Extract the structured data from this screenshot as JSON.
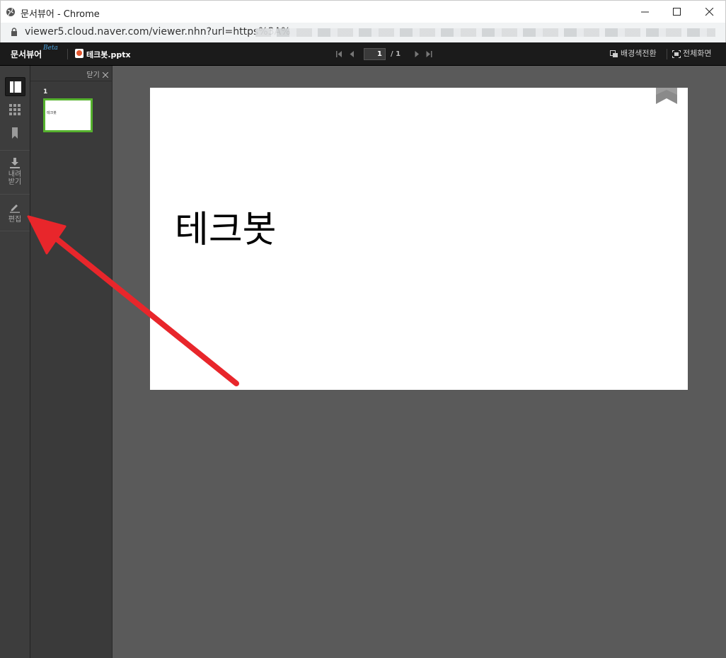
{
  "window": {
    "title": "문서뷰어 - Chrome",
    "url": "viewer5.cloud.naver.com/viewer.nhn?url=https%3A%"
  },
  "toolbar": {
    "brand": "문서뷰어",
    "beta": "Beta",
    "filename": "테크봇.pptx",
    "current_page": "1",
    "total_pages": "/ 1",
    "bg_toggle_label": "배경색전환",
    "fullscreen_label": "전체화면"
  },
  "rail": {
    "download_label_line1": "내려",
    "download_label_line2": "받기",
    "edit_label": "편집"
  },
  "thumbnails": {
    "close_label": "닫기",
    "items": [
      {
        "number": "1",
        "text": "테크봇"
      }
    ]
  },
  "slide": {
    "text": "테크봇"
  },
  "colors": {
    "accent_green": "#56b22e",
    "annotation_red": "#e8262b",
    "beta_blue": "#4aa3df"
  }
}
